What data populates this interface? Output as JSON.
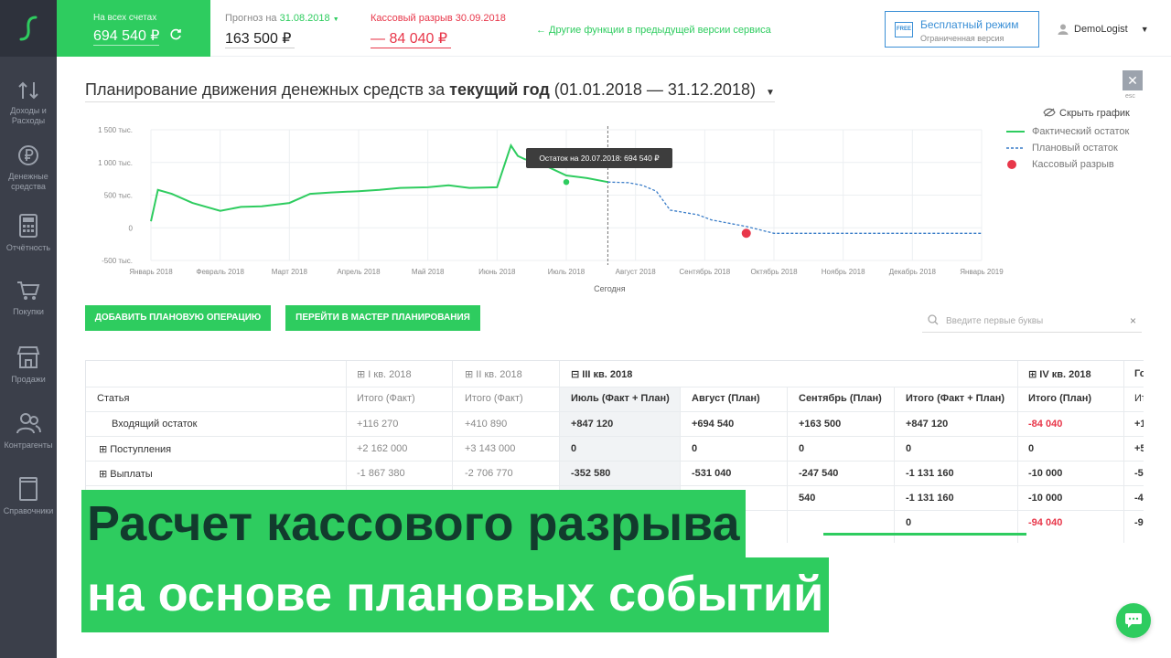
{
  "header": {
    "balance_label": "На всех счетах",
    "balance_value": "694 540 ₽",
    "forecast_label": "Прогноз на",
    "forecast_date": "31.08.2018",
    "forecast_value": "163 500 ₽",
    "gap_label": "Кассовый разрыв 30.09.2018",
    "gap_value": "— 84 040 ₽",
    "other_functions": "← Другие функции в предыдущей версии сервиса",
    "free_badge": "FREE",
    "free_title": "Бесплатный режим",
    "free_subtitle": "Ограниченная версия",
    "user_name": "DemoLogist"
  },
  "sidebar": {
    "items": [
      {
        "label1": "Доходы и",
        "label2": "Расходы",
        "icon": "arrows-updown-icon"
      },
      {
        "label1": "Денежные",
        "label2": "средства",
        "icon": "ruble-icon"
      },
      {
        "label1": "Отчётность",
        "label2": "",
        "icon": "calculator-icon"
      },
      {
        "label1": "Покупки",
        "label2": "",
        "icon": "cart-icon"
      },
      {
        "label1": "Продажи",
        "label2": "",
        "icon": "store-icon"
      },
      {
        "label1": "Контрагенты",
        "label2": "",
        "icon": "contacts-icon"
      },
      {
        "label1": "Справочники",
        "label2": "",
        "icon": "book-icon"
      }
    ]
  },
  "page": {
    "title_prefix": "Планирование движения денежных средств за",
    "title_period": "текущий год",
    "title_range": "(01.01.2018 — 31.12.2018)",
    "close_label": "✕",
    "esc_label": "esc",
    "hide_chart": "Скрыть график",
    "legend_fact": "Фактический остаток",
    "legend_plan": "Плановый остаток",
    "legend_gap": "Кассовый разрыв",
    "btn_add": "Добавить плановую операцию",
    "btn_master": "Перейти в мастер планирования",
    "search_placeholder": "Введите первые буквы"
  },
  "chart_data": {
    "type": "line",
    "y_ticks": [
      "1 500 тыс.",
      "1 000 тыс.",
      "500 тыс.",
      "0",
      "-500 тыс."
    ],
    "ylim": [
      -500,
      1500
    ],
    "x_ticks": [
      "Январь 2018",
      "Февраль 2018",
      "Март 2018",
      "Апрель 2018",
      "Май 2018",
      "Июнь 2018",
      "Июль 2018",
      "Август 2018",
      "Сентябрь 2018",
      "Октябрь 2018",
      "Ноябрь 2018",
      "Декабрь 2018",
      "Январь 2019"
    ],
    "today_label": "Сегодня",
    "tooltip": "Остаток на 20.07.2018: 694 540 ₽",
    "grid": true,
    "series": [
      {
        "name": "Фактический остаток",
        "color": "#2ecc5f",
        "x": [
          0,
          0.1,
          0.3,
          0.6,
          1.0,
          1.3,
          1.6,
          2.0,
          2.3,
          2.6,
          3.0,
          3.3,
          3.6,
          4.0,
          4.3,
          4.6,
          5.0,
          5.2,
          5.3,
          5.4,
          5.6,
          6.0,
          6.3,
          6.6
        ],
        "values": [
          100,
          580,
          520,
          380,
          260,
          320,
          330,
          380,
          520,
          540,
          560,
          580,
          610,
          620,
          650,
          610,
          620,
          1260,
          1100,
          1050,
          1000,
          800,
          760,
          700
        ]
      },
      {
        "name": "Плановый остаток",
        "color": "#3a7dc8",
        "x": [
          6.6,
          6.9,
          7.1,
          7.3,
          7.5,
          7.9,
          8.1,
          8.6,
          9.0,
          10.0,
          11.0,
          12.0
        ],
        "values": [
          700,
          690,
          650,
          560,
          270,
          200,
          120,
          20,
          -84,
          -84,
          -84,
          -84
        ]
      }
    ],
    "gap_point": {
      "x": 8.6,
      "y": -84
    }
  },
  "table": {
    "q1": "I кв. 2018",
    "q2": "II кв. 2018",
    "q3": "III кв. 2018",
    "q4": "IV кв. 2018",
    "year": "Го",
    "col_article": "Статья",
    "col_headers": [
      "Итого (Факт)",
      "Итого (Факт)",
      "Июль (Факт + План)",
      "Август (План)",
      "Сентябрь (План)",
      "Итого (Факт + План)",
      "Итого (План)",
      "Ит"
    ],
    "rows": [
      {
        "label": "Входящий остаток",
        "values": [
          "+116 270",
          "+410 890",
          "+847 120",
          "+694 540",
          "+163 500",
          "+847 120",
          "-84 040",
          "+1"
        ]
      },
      {
        "label": "Поступления",
        "values": [
          "+2 162 000",
          "+3 143 000",
          "0",
          "0",
          "0",
          "0",
          "0",
          "+5"
        ]
      },
      {
        "label": "Выплаты",
        "values": [
          "-1 867 380",
          "-2 706 770",
          "-352 580",
          "-531 040",
          "-247 540",
          "-1 131 160",
          "-10 000",
          "-5"
        ]
      },
      {
        "label": "",
        "values": [
          "",
          "",
          "",
          "",
          "540",
          "-1 131 160",
          "-10 000",
          "-4"
        ]
      },
      {
        "label": "",
        "values": [
          "",
          "",
          "",
          "",
          "",
          "0",
          "-94 040",
          "-9"
        ]
      }
    ]
  },
  "banner": {
    "line1": "Расчет кассового разрыва",
    "line2": "на основе плановых событий"
  },
  "colors": {
    "accent": "#2ecc5f",
    "danger": "#e8374a",
    "plan": "#3a7dc8",
    "sidebar": "#3b3f4a"
  }
}
